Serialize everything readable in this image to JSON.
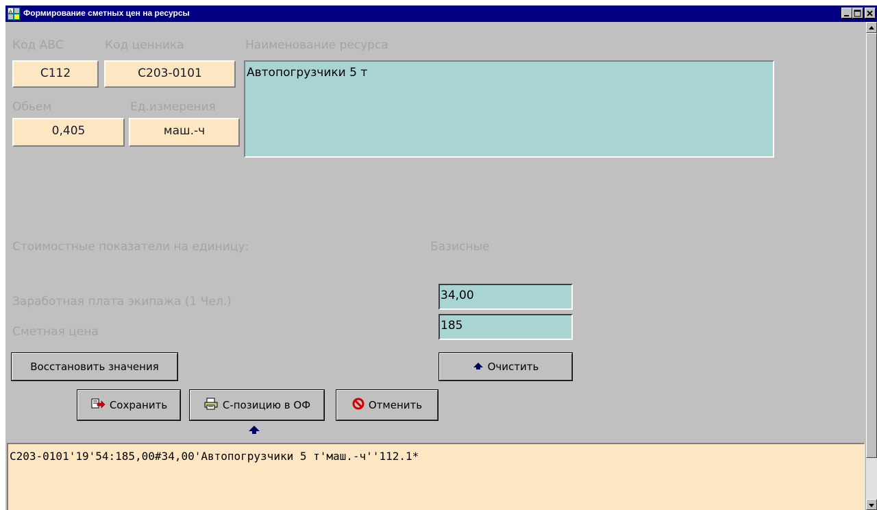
{
  "window": {
    "title": "Формирование сметных цен на ресурсы",
    "controls": [
      "minimize-icon",
      "maximize-icon",
      "close-icon"
    ]
  },
  "labels": {
    "code_abc": "Код АВС",
    "code_price": "Код ценника",
    "resource_name": "Наименование ресурса",
    "volume": "Обьем",
    "unit": "Ед.измерения",
    "cost_indicators": "Стоимостные показатели на единицу:",
    "basic": "Базисные",
    "crew_salary": "Заработная плата экипажа  (1 Чел.)",
    "estimate_price": "Сметная цена"
  },
  "fields": {
    "code_abc": "С112",
    "code_price": "С203-0101",
    "resource_name": "Автопогрузчики 5 т",
    "volume": "0,405",
    "unit": "маш.-ч",
    "crew_salary": "34,00",
    "estimate_price": "185"
  },
  "buttons": {
    "restore": "Восстановить значения",
    "clear": "Очистить",
    "save": "Сохранить",
    "to_of": "С-позицию в ОФ",
    "cancel": "Отменить"
  },
  "output": {
    "text": "С203-0101'19'54:185,00#34,00'Автопогрузчики 5 т'маш.-ч''112.1*"
  },
  "colors": {
    "title_bar": "#000080",
    "window_bg": "#c0c0c0",
    "peach_field": "#fde7c3",
    "teal_field": "#a8d4d4",
    "label_gray": "#a4a4a4"
  },
  "icons": {
    "save": "save-arrow-icon",
    "to_of": "printer-icon",
    "cancel": "no-entry-icon",
    "clear": "arrow-up-icon"
  }
}
